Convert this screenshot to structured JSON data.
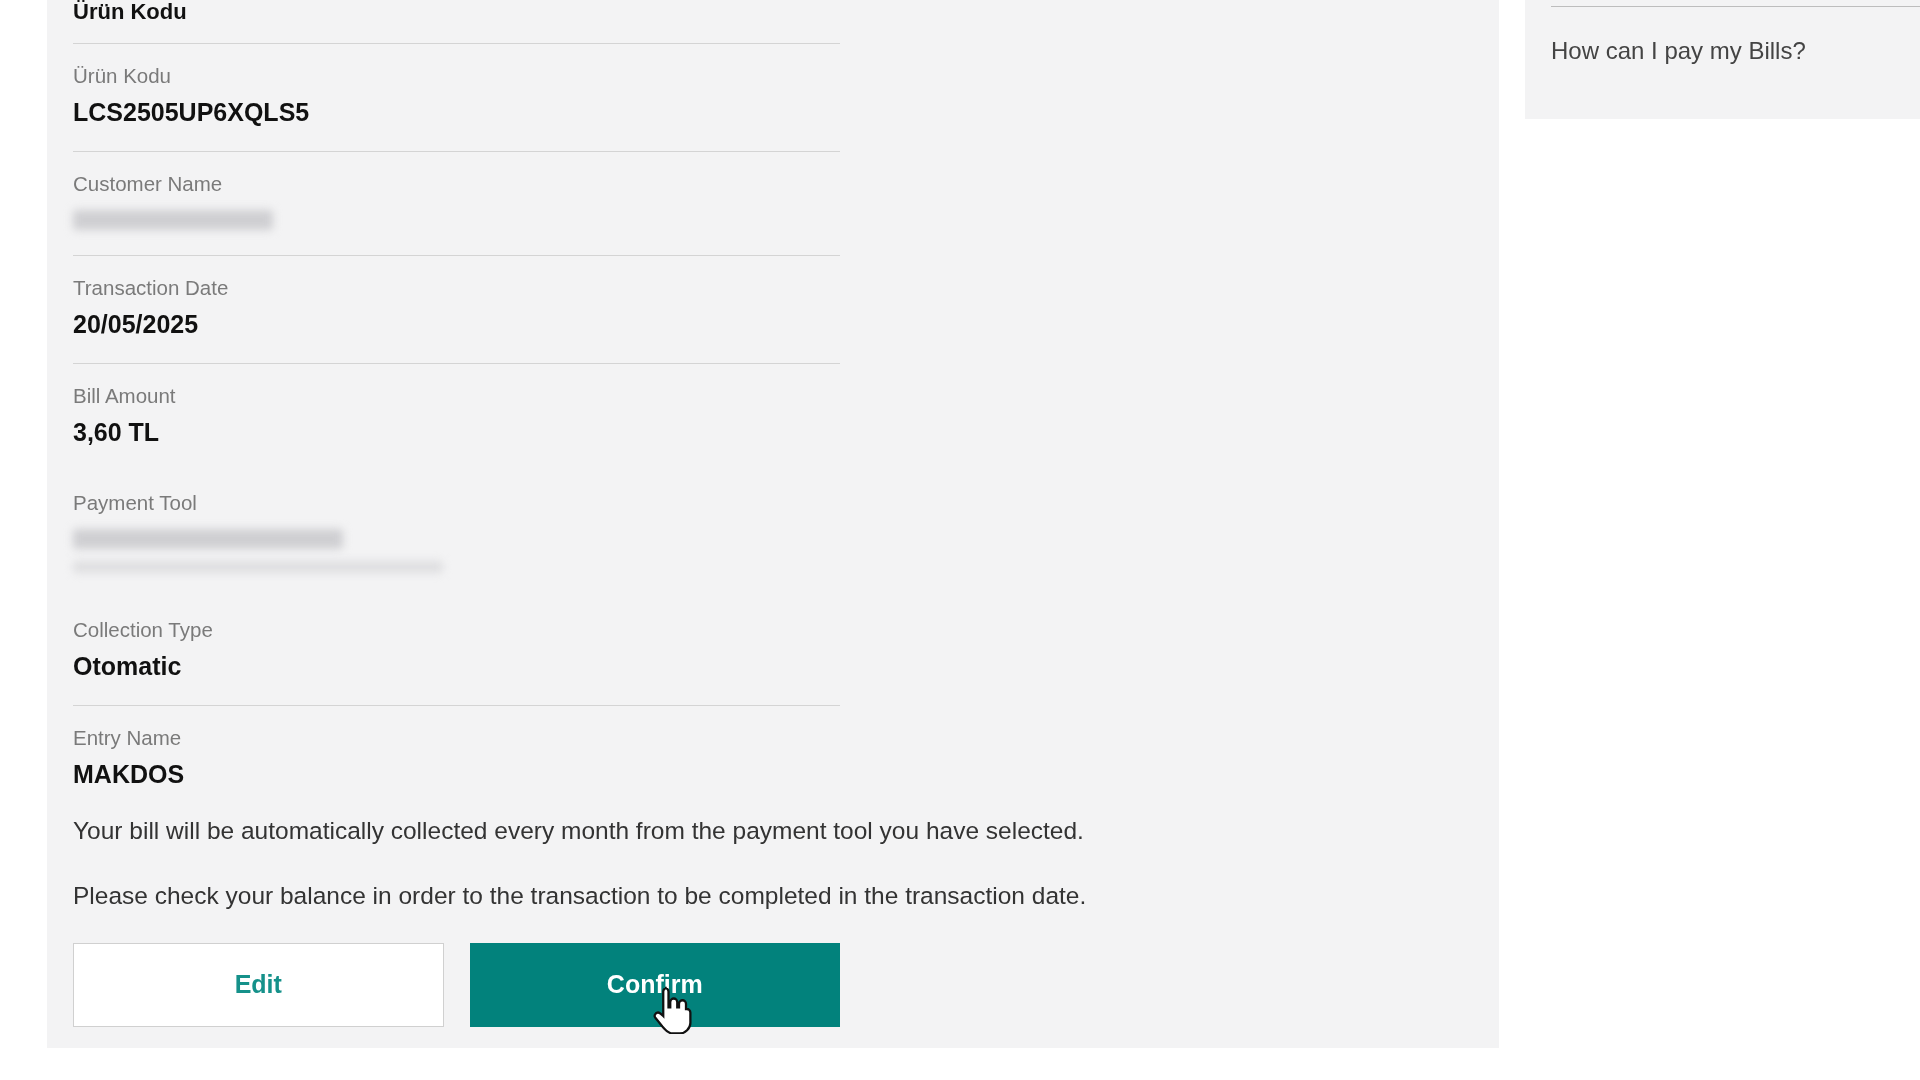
{
  "section_title": "Ürün Kodu",
  "fields": [
    {
      "kind": "text",
      "label": "Ürün Kodu",
      "value": "LCS2505UP6XQLS5",
      "divider": true
    },
    {
      "kind": "masked",
      "label": "Customer Name",
      "divider": true
    },
    {
      "kind": "text",
      "label": "Transaction Date",
      "value": "20/05/2025",
      "divider": true
    },
    {
      "kind": "text",
      "label": "Bill Amount",
      "value": "3,60 TL",
      "divider": false
    },
    {
      "kind": "masked-detail",
      "label": "Payment Tool",
      "divider": false
    },
    {
      "kind": "text",
      "label": "Collection Type",
      "value": "Otomatic",
      "divider": true
    },
    {
      "kind": "text",
      "label": "Entry Name",
      "value": "MAKDOS",
      "divider": false
    }
  ],
  "notes": [
    "Your bill will be automatically collected every month from the payment tool you have selected.",
    "Please check your balance in order to the transaction to be completed in the transaction date."
  ],
  "buttons": [
    {
      "kind": "outline",
      "label": "Edit"
    },
    {
      "kind": "primary",
      "label": "Confirm",
      "hovered": true
    }
  ],
  "help_panel": {
    "link": "How can I pay my Bills?"
  }
}
